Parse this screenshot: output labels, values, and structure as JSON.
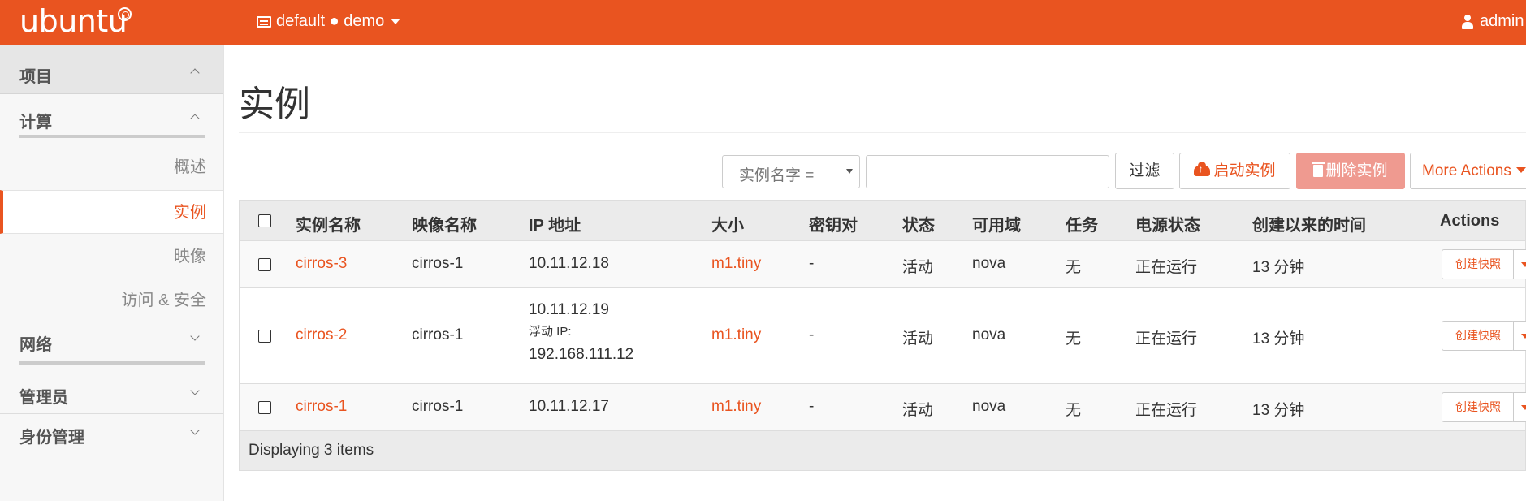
{
  "topbar": {
    "logo": "ubuntu",
    "context": "default ● demo",
    "user": "admin",
    "brand_color": "#e95420"
  },
  "sidebar": {
    "project": "项目",
    "compute": "计算",
    "items": [
      {
        "label": "概述",
        "active": false
      },
      {
        "label": "实例",
        "active": true
      },
      {
        "label": "映像",
        "active": false
      },
      {
        "label": "访问 & 安全",
        "active": false
      }
    ],
    "network": "网络",
    "admin": "管理员",
    "identity": "身份管理"
  },
  "page": {
    "title": "实例"
  },
  "toolbar": {
    "filter_field": "实例名字 =",
    "filter_value": "",
    "filter_button": "过滤",
    "launch_button": "启动实例",
    "delete_button": "删除实例",
    "more_actions": "More Actions"
  },
  "table": {
    "headers": {
      "name": "实例名称",
      "image": "映像名称",
      "ip": "IP 地址",
      "size": "大小",
      "keypair": "密钥对",
      "status": "状态",
      "az": "可用域",
      "task": "任务",
      "power": "电源状态",
      "age": "创建以来的时间",
      "actions": "Actions"
    },
    "rows": [
      {
        "name": "cirros-3",
        "image": "cirros-1",
        "ip": "10.11.12.18",
        "size": "m1.tiny",
        "keypair": "-",
        "status": "活动",
        "az": "nova",
        "task": "无",
        "power": "正在运行",
        "age": "13 分钟",
        "action": "创建快照"
      },
      {
        "name": "cirros-2",
        "image": "cirros-1",
        "ip": "10.11.12.19",
        "floating_label": "浮动 IP:",
        "floating_ip": "192.168.111.12",
        "size": "m1.tiny",
        "keypair": "-",
        "status": "活动",
        "az": "nova",
        "task": "无",
        "power": "正在运行",
        "age": "13 分钟",
        "action": "创建快照"
      },
      {
        "name": "cirros-1",
        "image": "cirros-1",
        "ip": "10.11.12.17",
        "size": "m1.tiny",
        "keypair": "-",
        "status": "活动",
        "az": "nova",
        "task": "无",
        "power": "正在运行",
        "age": "13 分钟",
        "action": "创建快照"
      }
    ],
    "footer": "Displaying 3 items"
  }
}
